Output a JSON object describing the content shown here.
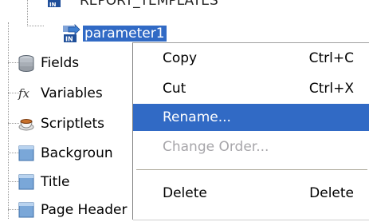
{
  "tree": {
    "clipped_item_label": "REPORT_TEMPLATES",
    "selected_item_label": "parameter1",
    "items": [
      {
        "label": "Fields",
        "icon": "database-icon"
      },
      {
        "label": "Variables",
        "icon": "fx-icon"
      },
      {
        "label": "Scriptlets",
        "icon": "cup-icon"
      },
      {
        "label": "Backgroun",
        "icon": "band-icon"
      },
      {
        "label": "Title",
        "icon": "band-icon"
      },
      {
        "label": "Page Header",
        "icon": "band-icon"
      }
    ]
  },
  "context_menu": {
    "items": [
      {
        "label": "Copy",
        "shortcut": "Ctrl+C",
        "state": "normal"
      },
      {
        "label": "Cut",
        "shortcut": "Ctrl+X",
        "state": "normal"
      },
      {
        "label": "Rename...",
        "shortcut": "",
        "state": "highlighted"
      },
      {
        "label": "Change Order...",
        "shortcut": "",
        "state": "disabled"
      },
      {
        "label": "Delete",
        "shortcut": "Delete",
        "state": "normal"
      }
    ]
  },
  "colors": {
    "selection": "#316ac5",
    "disabled_text": "#a7a6aa",
    "band_icon_blue": "#7aa7d8"
  }
}
